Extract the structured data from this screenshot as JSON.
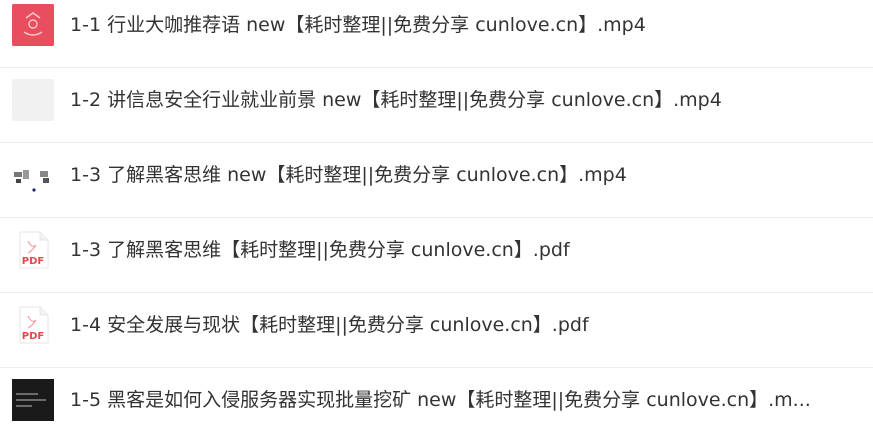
{
  "files": [
    {
      "name": "1-1 行业大咖推荐语 new【耗时整理||免费分享 cunlove.cn】.mp4",
      "thumb_icon": "video-thumbnail-icon",
      "thumb_color": "#e94e5e"
    },
    {
      "name": "1-2 讲信息安全行业就业前景 new【耗时整理||免费分享 cunlove.cn】.mp4",
      "thumb_icon": "video-thumbnail-icon",
      "thumb_color": "#f1f1f1"
    },
    {
      "name": "1-3 了解黑客思维 new【耗时整理||免费分享 cunlove.cn】.mp4",
      "thumb_icon": "video-thumbnail-icon",
      "thumb_color": "#ffffff"
    },
    {
      "name": "1-3 了解黑客思维【耗时整理||免费分享 cunlove.cn】.pdf",
      "thumb_icon": "pdf-file-icon",
      "thumb_label": "PDF",
      "thumb_color": "#e5484d"
    },
    {
      "name": "1-4 安全发展与现状【耗时整理||免费分享 cunlove.cn】.pdf",
      "thumb_icon": "pdf-file-icon",
      "thumb_label": "PDF",
      "thumb_color": "#e5484d"
    },
    {
      "name": "1-5 黑客是如何入侵服务器实现批量挖矿 new【耗时整理||免费分享 cunlove.cn】.m...",
      "thumb_icon": "video-thumbnail-icon",
      "thumb_color": "#1a1a1a"
    }
  ]
}
